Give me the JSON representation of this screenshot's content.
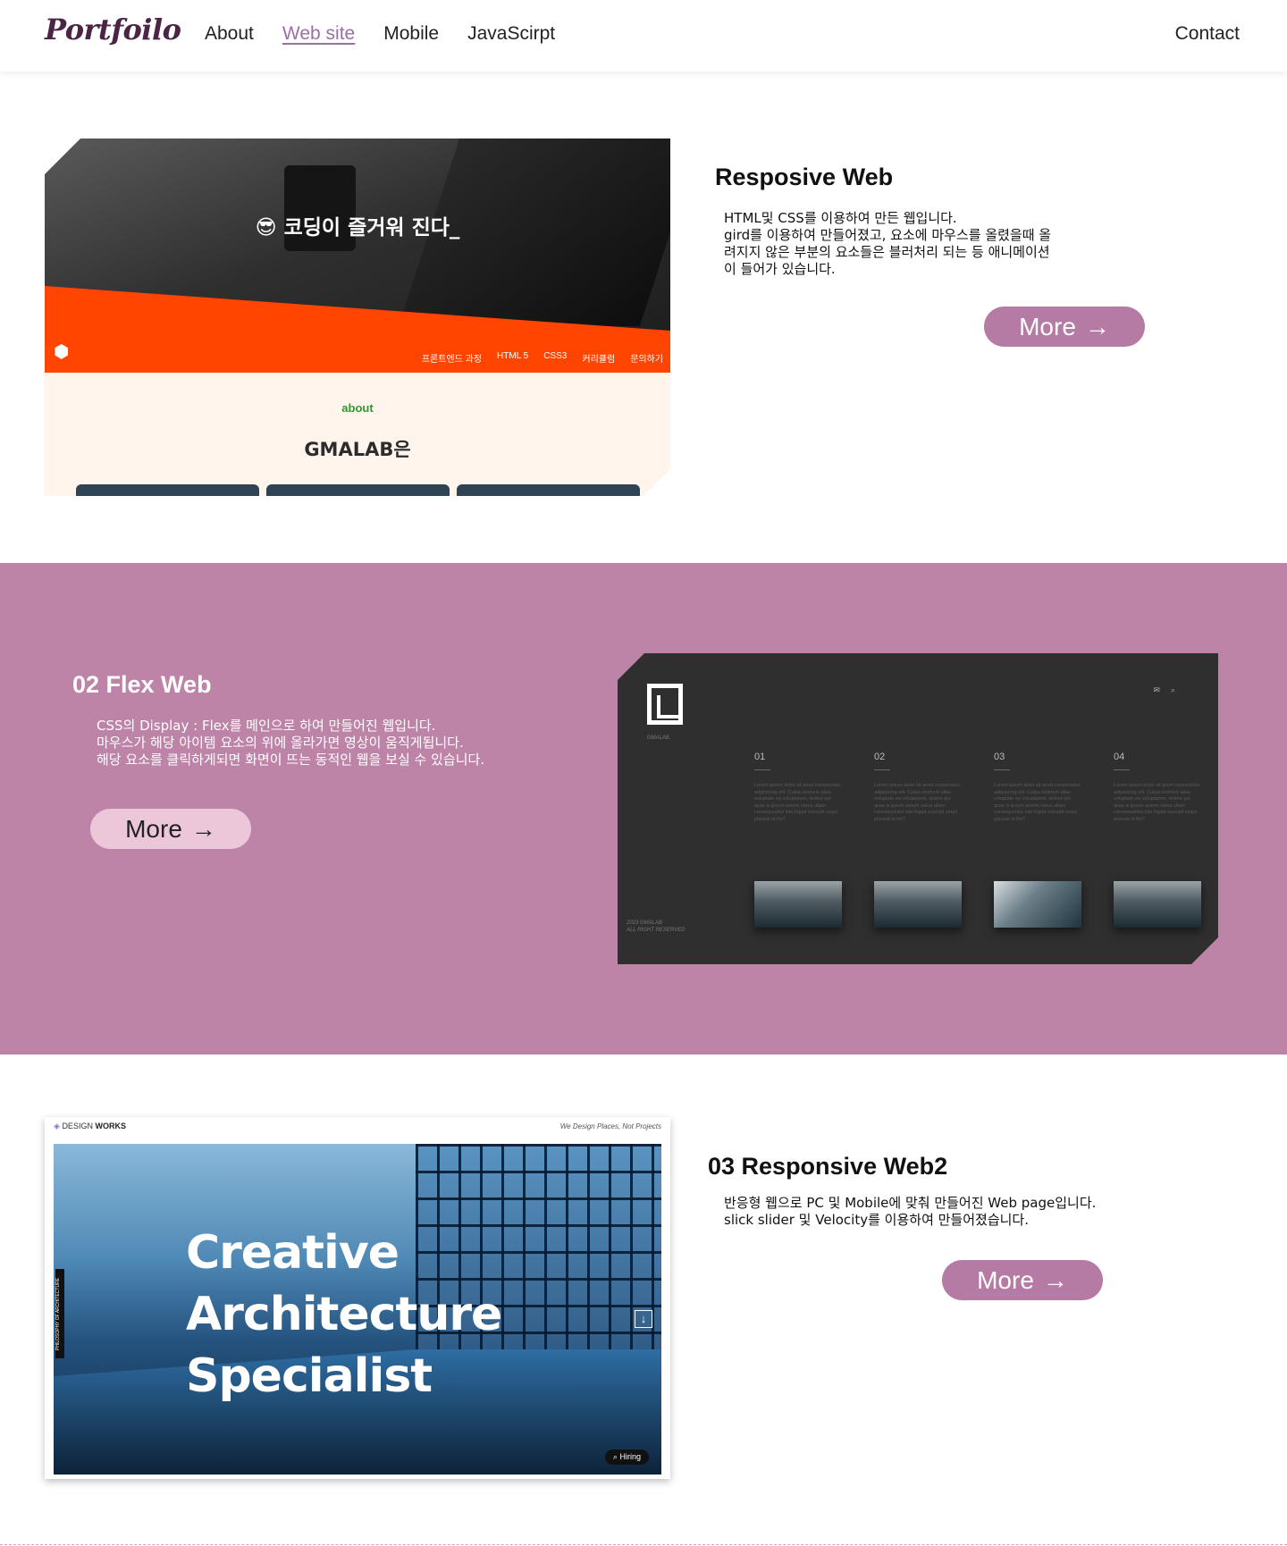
{
  "header": {
    "logo": "Portfoilo",
    "nav": [
      "About",
      "Web site",
      "Mobile",
      "JavaScirpt"
    ],
    "active_nav": "Web site",
    "contact": "Contact"
  },
  "section1": {
    "title": "Resposive Web",
    "desc": [
      "HTML및 CSS를 이용하여 만든 웹입니다.",
      "gird를 이용하여 만들어졌고, 요소에 마우스를 올렸을때 올",
      "려지지 않은 부분의 요소들은 블러처리 되는 등 애니메이션",
      "이 들어가 있습니다."
    ],
    "more": "More",
    "arrow": "→",
    "preview": {
      "hero_text": "😎 코딩이 즐거워 진다_",
      "menu": [
        "프론트엔드 과정",
        "HTML 5",
        "CSS3",
        "커리큘럼",
        "문의하기"
      ],
      "about_label": "about",
      "heading": "GMALAB은"
    }
  },
  "section2": {
    "title": "02 Flex Web",
    "desc": [
      "CSS의 Display : Flex를 메인으로 하여 만들어진 웹입니다.",
      "마우스가 해당 아이템 요소의 위에 올라가면 영상이 움직게됩니다.",
      "해당 요소를 클릭하게되면 화면이 뜨는 동적인 웹을 보실 수 있습니다."
    ],
    "more": "More",
    "arrow": "→",
    "preview": {
      "logo_label": "GMALAB",
      "icons": [
        "✉",
        "⌕"
      ],
      "columns": [
        {
          "num": "01",
          "text": "Lorem ipsum dolor sit amet consectetur, adipisicing elit. Culpa nostrum alias voluptate ea voluptatem, dolore qui quas is ipsum autem natus ullam consequuntur iste fugiat suscipit sequi placeat id illo?"
        },
        {
          "num": "02",
          "text": "Lorem ipsum dolor sit amet consectetur, adipisicing elit. Culpa nostrum alias voluptate ea voluptatem, dolore qui quas is ipsum autem natus ullam consequuntur iste fugiat suscipit sequi placeat id illo?"
        },
        {
          "num": "03",
          "text": "Lorem ipsum dolor sit amet consectetur, adipisicing elit. Culpa nostrum alias voluptate ea voluptatem, dolore qui quas is ipsum autem natus ullam consequuntur iste fugiat suscipit sequi placeat id illo?"
        },
        {
          "num": "04",
          "text": "Lorem ipsum dolor sit amet consectetur, adipisicing elit. Culpa nostrum alias voluptate ea voluptatem, dolore qui quas is ipsum autem natus ullam consequuntur iste fugiat suscipit sequi placeat id illo?"
        }
      ],
      "footer": [
        "2023 GMALAB",
        "ALL RIGHT RESERVED"
      ]
    }
  },
  "section3": {
    "title": "03 Responsive Web2",
    "desc": [
      "반응형 웹으로 PC 및 Mobile에 맞춰 만들어진 Web page입니다.",
      "slick slider 및 Velocity를 이용하여 만들어졌습니다."
    ],
    "more": "More",
    "arrow": "→",
    "preview": {
      "brand_prefix": "DESIGN",
      "brand_suffix": "WORKS",
      "tagline": "We Design Places, Not Projects",
      "headline": [
        "Creative",
        "Architecture",
        "Specialist"
      ],
      "side_label": "PHILOSOPHY OF ARCHITECTURE",
      "hiring": "Hiring"
    }
  },
  "colors": {
    "brand": "#4a2545",
    "accent": "#b57ba5",
    "band": "#bd84a8",
    "button_light": "#ecc7d9",
    "orange": "#ff4500"
  }
}
